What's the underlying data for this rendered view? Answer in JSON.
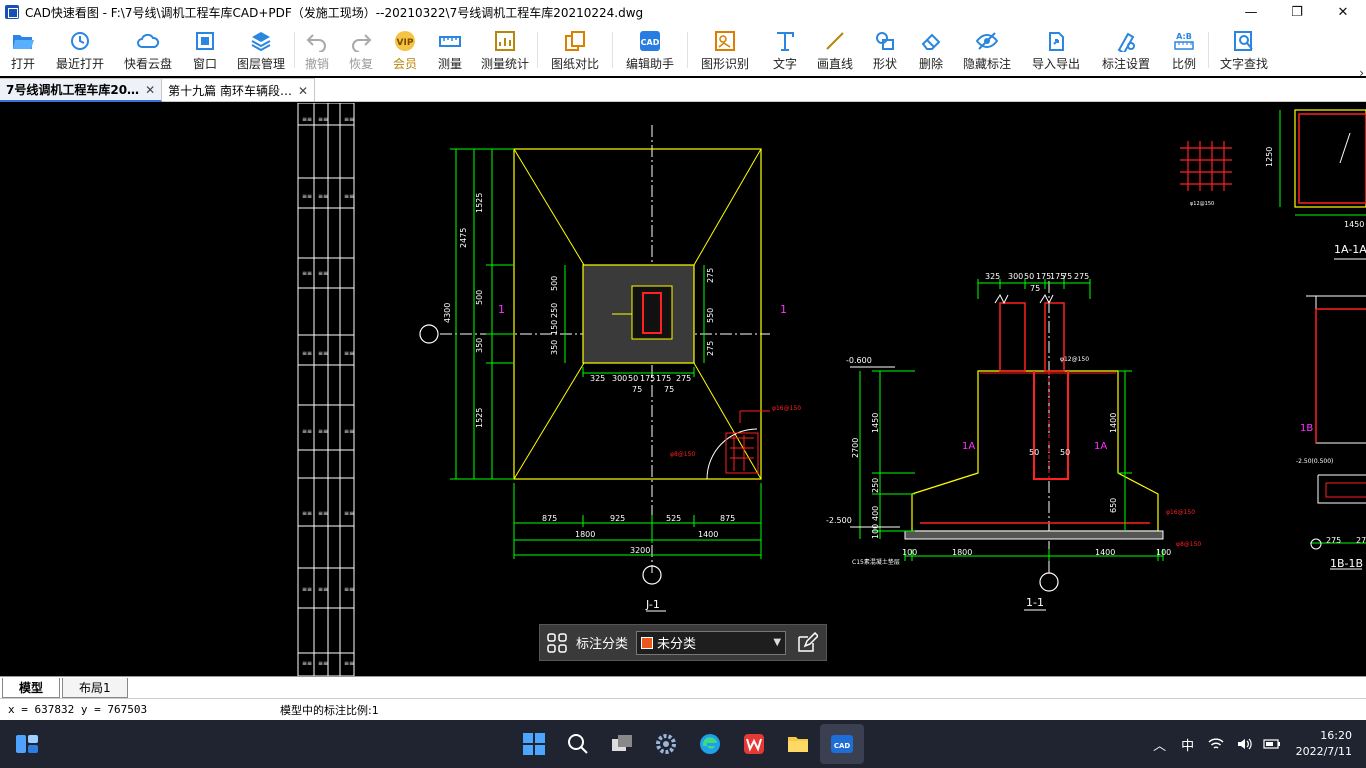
{
  "window": {
    "title": "CAD快速看图 - F:\\7号线\\调机工程车库CAD+PDF（发施工现场）--20210322\\7号线调机工程车库20210224.dwg",
    "minimize": "—",
    "restore": "❐",
    "close": "✕"
  },
  "toolbar": {
    "items": [
      {
        "label": "打开",
        "icon": "folder-open-icon",
        "disabled": false
      },
      {
        "label": "最近打开",
        "icon": "recent-clock-icon",
        "disabled": false
      },
      {
        "label": "快看云盘",
        "icon": "cloud-icon",
        "disabled": false
      },
      {
        "label": "窗口",
        "icon": "window-icon",
        "disabled": false
      },
      {
        "label": "图层管理",
        "icon": "layers-icon",
        "disabled": false
      },
      {
        "label": "撤销",
        "icon": "undo-icon",
        "disabled": true
      },
      {
        "label": "恢复",
        "icon": "redo-icon",
        "disabled": true
      },
      {
        "label": "会员",
        "icon": "vip-icon",
        "disabled": false
      },
      {
        "label": "测量",
        "icon": "ruler-icon",
        "disabled": false
      },
      {
        "label": "测量统计",
        "icon": "measure-stats-icon",
        "disabled": false
      },
      {
        "label": "图纸对比",
        "icon": "compare-icon",
        "disabled": false
      },
      {
        "label": "编辑助手",
        "icon": "edit-assistant-icon",
        "disabled": false
      },
      {
        "label": "图形识别",
        "icon": "shape-recognition-icon",
        "disabled": false
      },
      {
        "label": "文字",
        "icon": "text-icon",
        "disabled": false
      },
      {
        "label": "画直线",
        "icon": "line-icon",
        "disabled": false
      },
      {
        "label": "形状",
        "icon": "shape-icon",
        "disabled": false
      },
      {
        "label": "删除",
        "icon": "eraser-icon",
        "disabled": false
      },
      {
        "label": "隐藏标注",
        "icon": "hide-eye-icon",
        "disabled": false
      },
      {
        "label": "导入导出",
        "icon": "import-export-icon",
        "disabled": false
      },
      {
        "label": "标注设置",
        "icon": "annotation-settings-icon",
        "disabled": false
      },
      {
        "label": "比例",
        "icon": "scale-icon",
        "disabled": false
      },
      {
        "label": "文字查找",
        "icon": "text-search-icon",
        "disabled": false
      }
    ],
    "more": "›"
  },
  "tabs": [
    {
      "label": "7号线调机工程车库20…",
      "active": true
    },
    {
      "label": "第十九篇 南环车辆段…",
      "active": false
    }
  ],
  "drawing": {
    "labels": {
      "plan_title": "J-1",
      "section_title": "1-1",
      "section_1a": "1A-1A",
      "section_1b": "1B-1B",
      "mark_1": "1",
      "mark_1a": "1A",
      "mark_1b": "1B"
    },
    "dims_plan_bottom": [
      "875",
      "925",
      "525",
      "875"
    ],
    "dims_plan_bottom2": [
      "1800",
      "1400"
    ],
    "dims_plan_total": "3200",
    "dims_plan_left": [
      "1525",
      "500",
      "350",
      "1525"
    ],
    "dims_plan_left_total": "2475",
    "dims_plan_left_total2": "4300",
    "dims_col_bottom": [
      "325",
      "300",
      "50",
      "175",
      "175",
      "275"
    ],
    "dims_col_bottom2": [
      "75",
      "75"
    ],
    "dims_col_right": [
      "275",
      "550",
      "275"
    ],
    "dims_col_left": [
      "500",
      "250",
      "150",
      "350"
    ],
    "dims_sec_top": [
      "325",
      "300",
      "50",
      "175",
      "175",
      "75",
      "275"
    ],
    "dims_sec_left": [
      "1450",
      "2700",
      "250",
      "400",
      "100"
    ],
    "dims_sec_bottom": [
      "100",
      "1800",
      "1400",
      "100"
    ],
    "dims_sec_right": [
      "1400",
      "650"
    ],
    "elev_top": "-0.600",
    "elev_bottom": "-2.500",
    "sec_inner": [
      "50",
      "50",
      "75"
    ],
    "rebar_notes": [
      "φ16@150",
      "φ8@150",
      "φ12@150",
      "φ16@150",
      "C15素混凝土垫层"
    ],
    "right_dims": [
      "1450",
      "1250",
      "275",
      "27"
    ],
    "right_elev": "-2.50(0.500)"
  },
  "annotation_bar": {
    "label": "标注分类",
    "selected": "未分类",
    "swatch_color": "#e8571c"
  },
  "layout_tabs": [
    {
      "label": "模型",
      "active": true
    },
    {
      "label": "布局1",
      "active": false
    }
  ],
  "status": {
    "coords": "x = 637832  y = 767503",
    "scale": "模型中的标注比例:1"
  },
  "taskbar": {
    "apps": [
      "start-icon",
      "search-icon",
      "task-view-icon",
      "settings-icon",
      "edge-icon",
      "wps-icon",
      "file-explorer-icon",
      "cad-app-icon"
    ],
    "tray_ime": "中",
    "time": "16:20",
    "date": "2022/7/11"
  }
}
